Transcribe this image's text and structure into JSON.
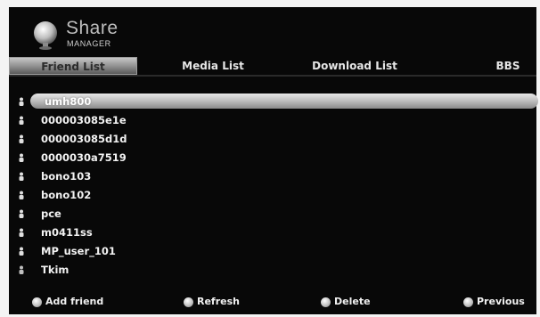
{
  "app": {
    "title_line1": "Share",
    "title_line2": "MANAGER",
    "logo_icon": "globe-person-icon"
  },
  "tabs": [
    {
      "label": "Friend List",
      "active": true
    },
    {
      "label": "Media List",
      "active": false
    },
    {
      "label": "Download List",
      "active": false
    },
    {
      "label": "BBS",
      "active": false
    }
  ],
  "friends": [
    {
      "name": "umh800",
      "selected": true,
      "icon": "person-icon"
    },
    {
      "name": "000003085e1e",
      "icon": "person-icon"
    },
    {
      "name": "000003085d1d",
      "icon": "person-icon"
    },
    {
      "name": "0000030a7519",
      "icon": "person-icon"
    },
    {
      "name": "bono103",
      "icon": "person-icon"
    },
    {
      "name": "bono102",
      "icon": "person-icon"
    },
    {
      "name": "pce",
      "icon": "person-icon"
    },
    {
      "name": "m0411ss",
      "icon": "person-icon"
    },
    {
      "name": "MP_user_101",
      "icon": "person-icon"
    },
    {
      "name": "Tkim",
      "icon": "person-icon"
    }
  ],
  "footer": [
    {
      "label": "Add friend",
      "icon": "button-dot-icon"
    },
    {
      "label": "Refresh",
      "icon": "button-dot-icon"
    },
    {
      "label": "Delete",
      "icon": "button-dot-icon"
    },
    {
      "label": "Previous",
      "icon": "button-dot-icon"
    }
  ]
}
